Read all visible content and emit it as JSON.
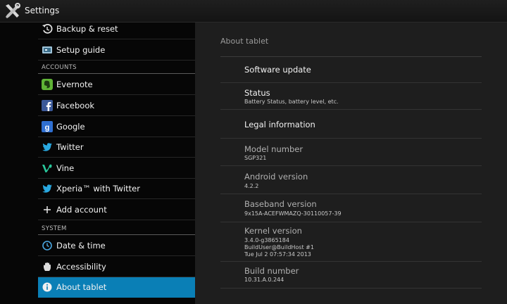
{
  "app": {
    "title": "Settings",
    "icon": "settings-tools-icon"
  },
  "sidebar": {
    "items_top": [
      {
        "label": "Backup & reset",
        "icon": "backup-reset-icon"
      },
      {
        "label": "Setup guide",
        "icon": "setup-guide-icon"
      }
    ],
    "accounts_header": "ACCOUNTS",
    "accounts": [
      {
        "label": "Evernote",
        "icon": "evernote-icon"
      },
      {
        "label": "Facebook",
        "icon": "facebook-icon"
      },
      {
        "label": "Google",
        "icon": "google-icon"
      },
      {
        "label": "Twitter",
        "icon": "twitter-icon"
      },
      {
        "label": "Vine",
        "icon": "vine-icon"
      },
      {
        "label": "Xperia™ with Twitter",
        "icon": "twitter-icon"
      },
      {
        "label": "Add account",
        "icon": "plus-icon"
      }
    ],
    "system_header": "SYSTEM",
    "system": [
      {
        "label": "Date & time",
        "icon": "clock-icon"
      },
      {
        "label": "Accessibility",
        "icon": "hand-icon"
      },
      {
        "label": "About tablet",
        "icon": "info-icon",
        "selected": true
      }
    ]
  },
  "about": {
    "title": "About tablet",
    "items": [
      {
        "title": "Software update"
      },
      {
        "title": "Status",
        "summary": [
          "Battery Status, battery level, etc."
        ]
      },
      {
        "title": "Legal information"
      },
      {
        "title": "Model number",
        "summary": [
          "SGP321"
        ]
      },
      {
        "title": "Android version",
        "summary": [
          "4.2.2"
        ]
      },
      {
        "title": "Baseband version",
        "summary": [
          "9x15A-ACEFWMAZQ-30110057-39"
        ]
      },
      {
        "title": "Kernel version",
        "summary": [
          "3.4.0-g3865184",
          "BuildUser@BuildHost #1",
          "Tue Jul 2 07:57:34 2013"
        ]
      },
      {
        "title": "Build number",
        "summary": [
          "10.31.A.0.244"
        ]
      }
    ]
  },
  "colors": {
    "accent": "#0a7fb6",
    "pane": "#1e1e1e",
    "list_bg": "#060606"
  }
}
